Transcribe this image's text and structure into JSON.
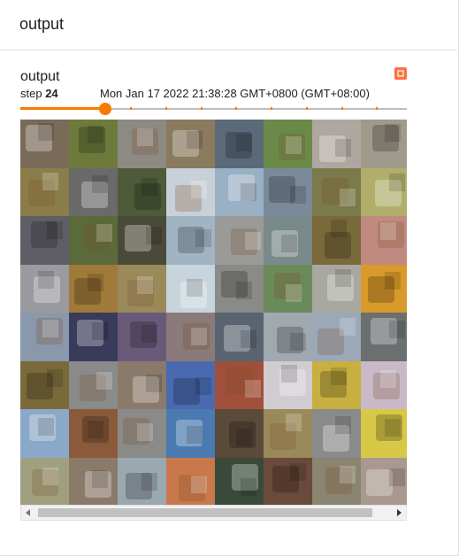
{
  "group": {
    "title": "output"
  },
  "card": {
    "title": "output",
    "step_label": "step",
    "step_value": "24",
    "timestamp": "Mon Jan 17 2022 21:38:28 GMT+0800 (GMT+08:00)",
    "slider": {
      "fraction": 0.22,
      "ticks": 10
    }
  },
  "grid": {
    "rows": 8,
    "cols": 8,
    "tiles": [
      [
        "#7a6a58",
        "#6e7a3c",
        "#8d8a84",
        "#8a7a5e",
        "#5a6a7a",
        "#6a8a4a",
        "#b0a6a0",
        "#a09a8a"
      ],
      [
        "#8a7d4a",
        "#6a6a6a",
        "#4e5a3a",
        "#c8d0d8",
        "#9ab0c4",
        "#7a8a9a",
        "#7a7a4a",
        "#b0ae6a"
      ],
      [
        "#5e5e66",
        "#5a6a3a",
        "#4a4a3a",
        "#a0b4c4",
        "#9a9a98",
        "#7a8a8a",
        "#7a6a3a",
        "#c08a80"
      ],
      [
        "#9a9aa0",
        "#a07a3a",
        "#9a8a5a",
        "#c8d4dc",
        "#8a8a88",
        "#6a8a5a",
        "#a8a8a0",
        "#d89a2a"
      ],
      [
        "#8a98ac",
        "#3a3a5a",
        "#6a5a7a",
        "#8a7a7a",
        "#5a6470",
        "#a0a8b0",
        "#9aa8b8",
        "#6a7070"
      ],
      [
        "#7a6a3a",
        "#8a8a8a",
        "#8a7a6a",
        "#4a6ab0",
        "#a0503a",
        "#d0ccd0",
        "#c8b040",
        "#c8b8c8"
      ],
      [
        "#8aa8c8",
        "#8a5a3a",
        "#8a8a88",
        "#4a7ab0",
        "#5a4a3a",
        "#9a8a5a",
        "#8a8a8a",
        "#d8c848"
      ],
      [
        "#a0a080",
        "#8a7a6a",
        "#9aa8b0",
        "#c8784a",
        "#3a4a3a",
        "#6a4a3a",
        "#8a8470",
        "#a89890"
      ]
    ]
  },
  "icons": {
    "expand": "expand-icon",
    "scroll_left": "arrow-left-icon",
    "scroll_right": "arrow-right-icon"
  },
  "colors": {
    "accent": "#f57c00",
    "expand": "#ff7043"
  }
}
